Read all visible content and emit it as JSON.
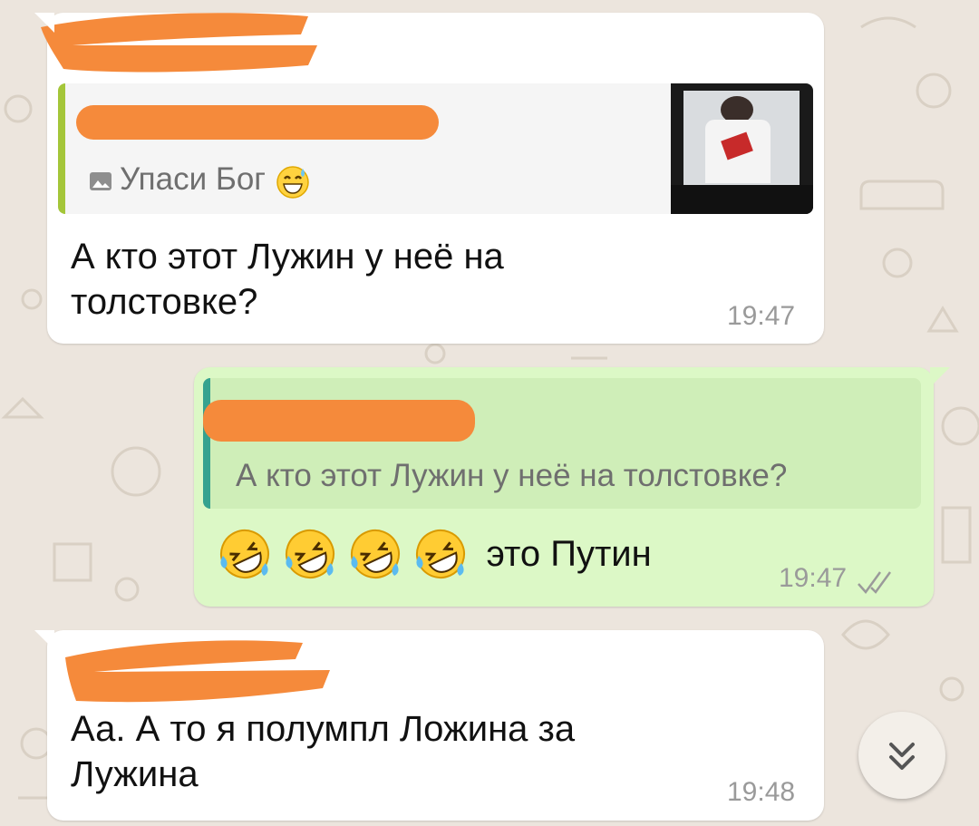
{
  "messages": [
    {
      "direction": "incoming",
      "reply": {
        "kind": "photo",
        "icon": "photo-icon",
        "text": "Упаси Бог",
        "emoji": "sweat-smile-icon"
      },
      "text_lines": [
        "А кто этот Лужин у неё на",
        "толстовке?"
      ],
      "time": "19:47"
    },
    {
      "direction": "outgoing",
      "reply": {
        "text": "А кто этот Лужин у неё на толстовке?"
      },
      "emoji_icon": "rofl-icon",
      "emoji_count": 4,
      "text": "это Путин",
      "time": "19:47",
      "status_icon": "double-check-icon"
    },
    {
      "direction": "incoming",
      "text_lines": [
        "Аа. А то я полумпл Ложина за",
        "Лужина"
      ],
      "time": "19:48"
    }
  ],
  "scroll_button": {
    "icon": "double-chevron-down-icon"
  },
  "colors": {
    "background": "#ece5dd",
    "incoming_bubble": "#ffffff",
    "outgoing_bubble": "#dcf8c6",
    "redaction": "#f58a3b",
    "quote_bar_incoming": "#a4c639",
    "quote_bar_outgoing": "#35a28f"
  }
}
